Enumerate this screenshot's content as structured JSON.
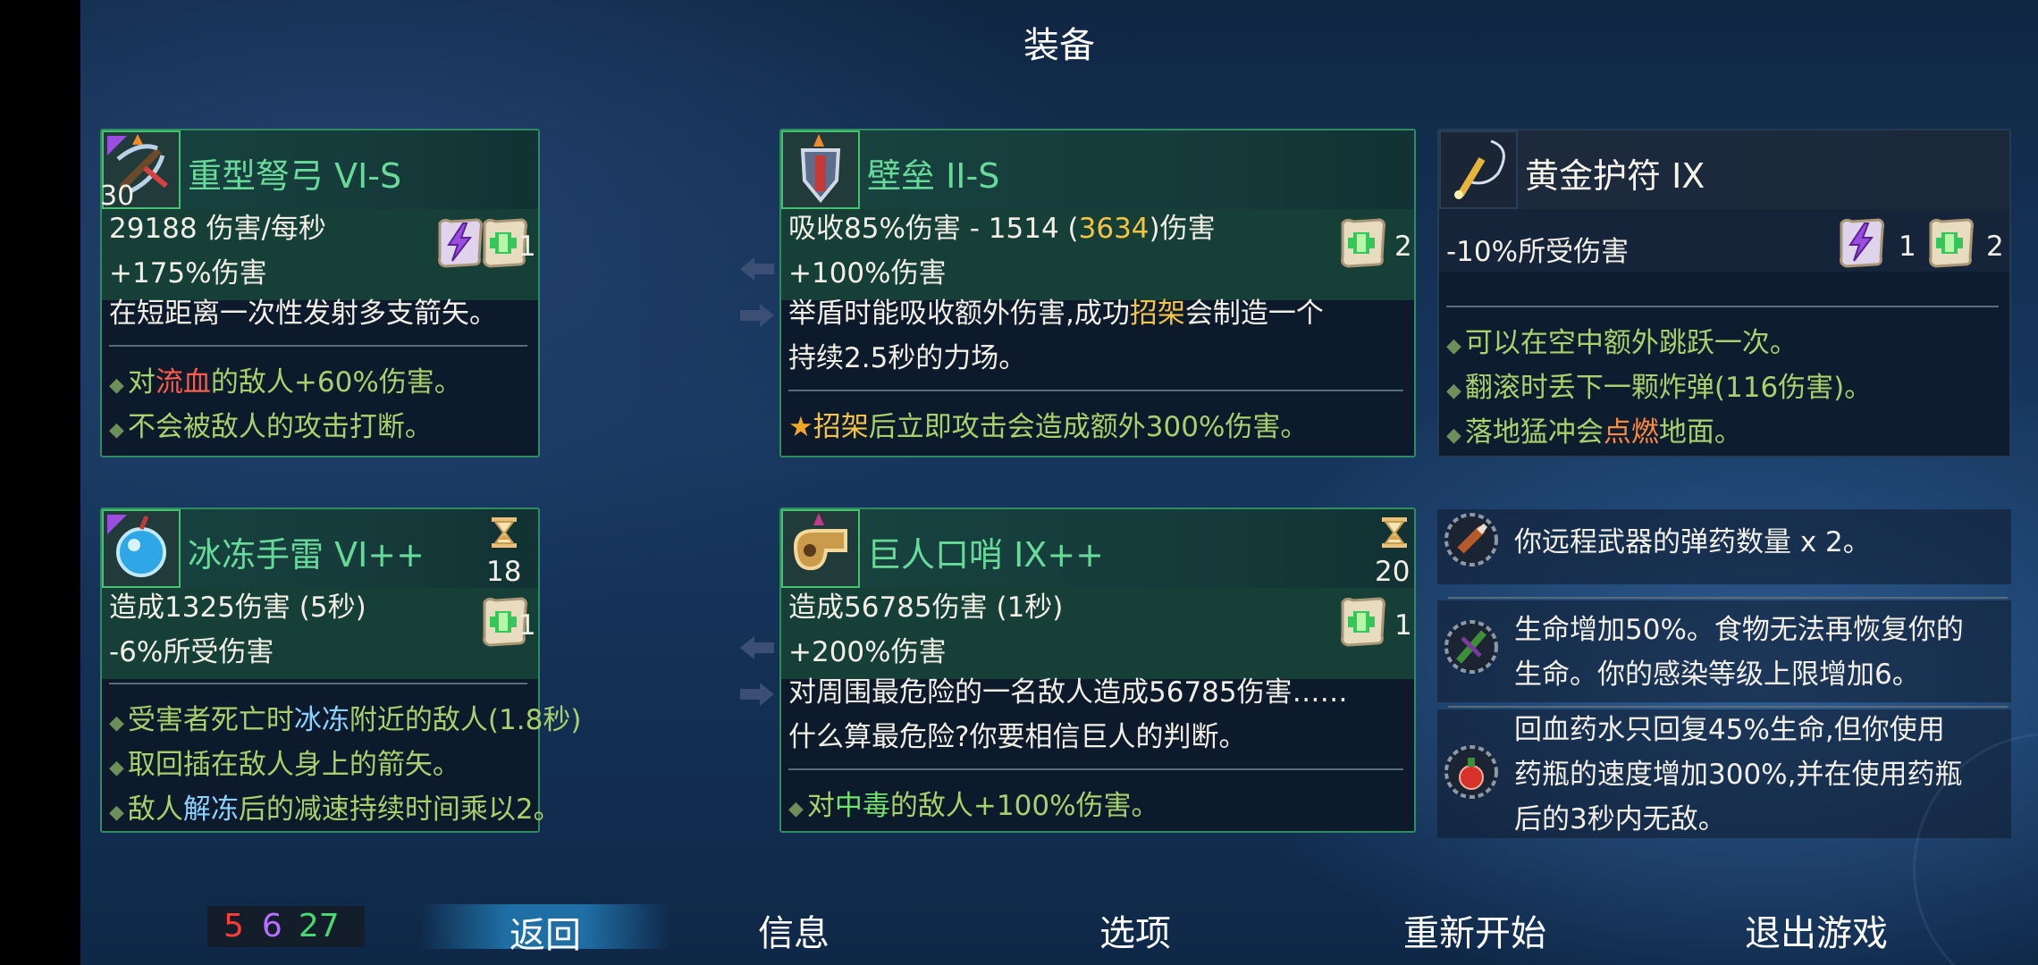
{
  "screen_title": "装备",
  "weapons": [
    {
      "name": "重型弩弓 VI-S",
      "level_badge": "30",
      "stat1": "29188 伤害/每秒",
      "stat2": "+175%伤害",
      "description": "在短距离一次性发射多支箭矢。",
      "scrolls": [
        {
          "type": "tactics",
          "count": "1"
        },
        {
          "type": "survival",
          "count": "1"
        }
      ],
      "affixes": [
        {
          "pre": "对",
          "hl": "流血",
          "post": "的敌人+60%伤害。"
        },
        {
          "pre": "不会被敌人的攻击打断。",
          "hl": "",
          "post": ""
        }
      ]
    },
    {
      "name": "壁垒 II-S",
      "stat1_pre": "吸收85%伤害  -  1514 (",
      "stat1_hl": "3634",
      "stat1_post": ")伤害",
      "stat2": "+100%伤害",
      "desc_line1_pre": "举盾时能吸收额外伤害,成功",
      "desc_line1_hl": "招架",
      "desc_line1_post": "会制造一个",
      "desc_line2": "持续2.5秒的力场。",
      "scrolls": [
        {
          "type": "survival",
          "count": "2"
        }
      ],
      "affix_hl": "招架",
      "affix_post": "后立即攻击会造成额外300%伤害。"
    },
    {
      "name": "黄金护符 IX",
      "stat1": "-10%所受伤害",
      "scrolls": [
        {
          "type": "tactics",
          "count": "1"
        },
        {
          "type": "survival",
          "count": "2"
        }
      ],
      "affixes": [
        {
          "pre": "可以在空中额外跳跃一次。",
          "hl": "",
          "post": ""
        },
        {
          "pre": "翻滚时丢下一颗炸弹(116伤害)。",
          "hl": "",
          "post": ""
        },
        {
          "pre": "落地猛冲会",
          "hl": "点燃",
          "post": "地面。"
        }
      ]
    }
  ],
  "skills": [
    {
      "name": "冰冻手雷 VI++",
      "cooldown": "18",
      "stat1": "造成1325伤害 (5秒)",
      "stat2": "-6%所受伤害",
      "scrolls": [
        {
          "type": "survival",
          "count": "1"
        }
      ],
      "affixes": [
        {
          "pre": "受害者死亡时",
          "hl": "冰冻",
          "post": "附近的敌人(1.8秒)"
        },
        {
          "pre": "取回插在敌人身上的箭矢。",
          "hl": "",
          "post": ""
        },
        {
          "pre": "敌人",
          "hl": "解冻",
          "post": "后的减速持续时间乘以2。"
        }
      ]
    },
    {
      "name": "巨人口哨 IX++",
      "cooldown": "20",
      "stat1": "造成56785伤害 (1秒)",
      "stat2": "+200%伤害",
      "desc_line1": "对周围最危险的一名敌人造成56785伤害……",
      "desc_line2": "什么算最危险?你要相信巨人的判断。",
      "scrolls": [
        {
          "type": "survival",
          "count": "1"
        }
      ],
      "affix_pre": "对",
      "affix_hl": "中毒",
      "affix_post": "的敌人+100%伤害。"
    }
  ],
  "mutations": [
    {
      "icon": "ammo-mutation-icon",
      "lines": [
        "你远程武器的弹药数量 x 2。"
      ]
    },
    {
      "icon": "necromancy-mutation-icon",
      "lines": [
        "生命增加50%。食物无法再恢复你的",
        "生命。你的感染等级上限增加6。"
      ]
    },
    {
      "icon": "potion-mutation-icon",
      "lines": [
        "回血药水只回复45%生命,但你使用",
        "药瓶的速度增加300%,并在使用药瓶",
        "后的3秒内无敌。"
      ]
    }
  ],
  "scroll_counts": {
    "brutality": "5",
    "tactics": "6",
    "survival": "27"
  },
  "menu": {
    "back": "返回",
    "info": "信息",
    "options": "选项",
    "restart": "重新开始",
    "quit": "退出游戏"
  },
  "colors": {
    "brutality": "#ff3b3b",
    "tactics": "#b770ff",
    "survival": "#47d873",
    "panel_border": "#2f8b61",
    "name_green": "#69d99a"
  }
}
